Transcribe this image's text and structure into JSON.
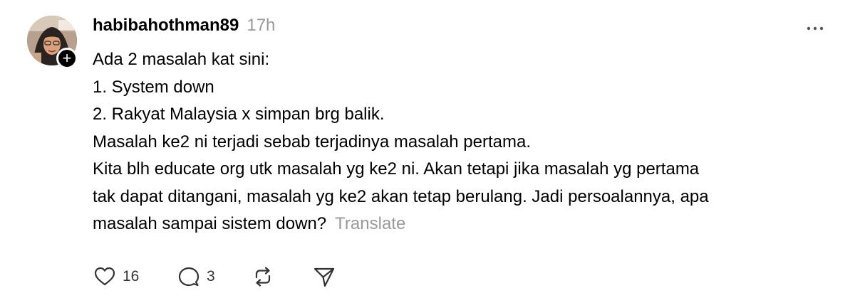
{
  "post": {
    "username": "habibahothman89",
    "timestamp": "17h",
    "body_lines": [
      "Ada 2 masalah kat sini:",
      "1. System down",
      "2. Rakyat Malaysia x simpan brg balik.",
      "Masalah ke2 ni terjadi sebab terjadinya masalah pertama.",
      "Kita blh educate org utk masalah yg ke2 ni. Akan tetapi jika masalah yg pertama",
      "tak dapat ditangani, masalah yg ke2 akan tetap berulang. Jadi persoalannya, apa",
      "masalah sampai sistem down?"
    ],
    "translate_label": "Translate",
    "follow_badge": "+",
    "more_icon": "more-horizontal-icon"
  },
  "actions": {
    "like_count": "16",
    "reply_count": "3",
    "like_icon": "heart-icon",
    "reply_icon": "comment-icon",
    "repost_icon": "repost-icon",
    "share_icon": "send-icon"
  },
  "colors": {
    "text": "#000000",
    "muted": "#999999",
    "icon": "#333333",
    "badge": "#000000"
  }
}
